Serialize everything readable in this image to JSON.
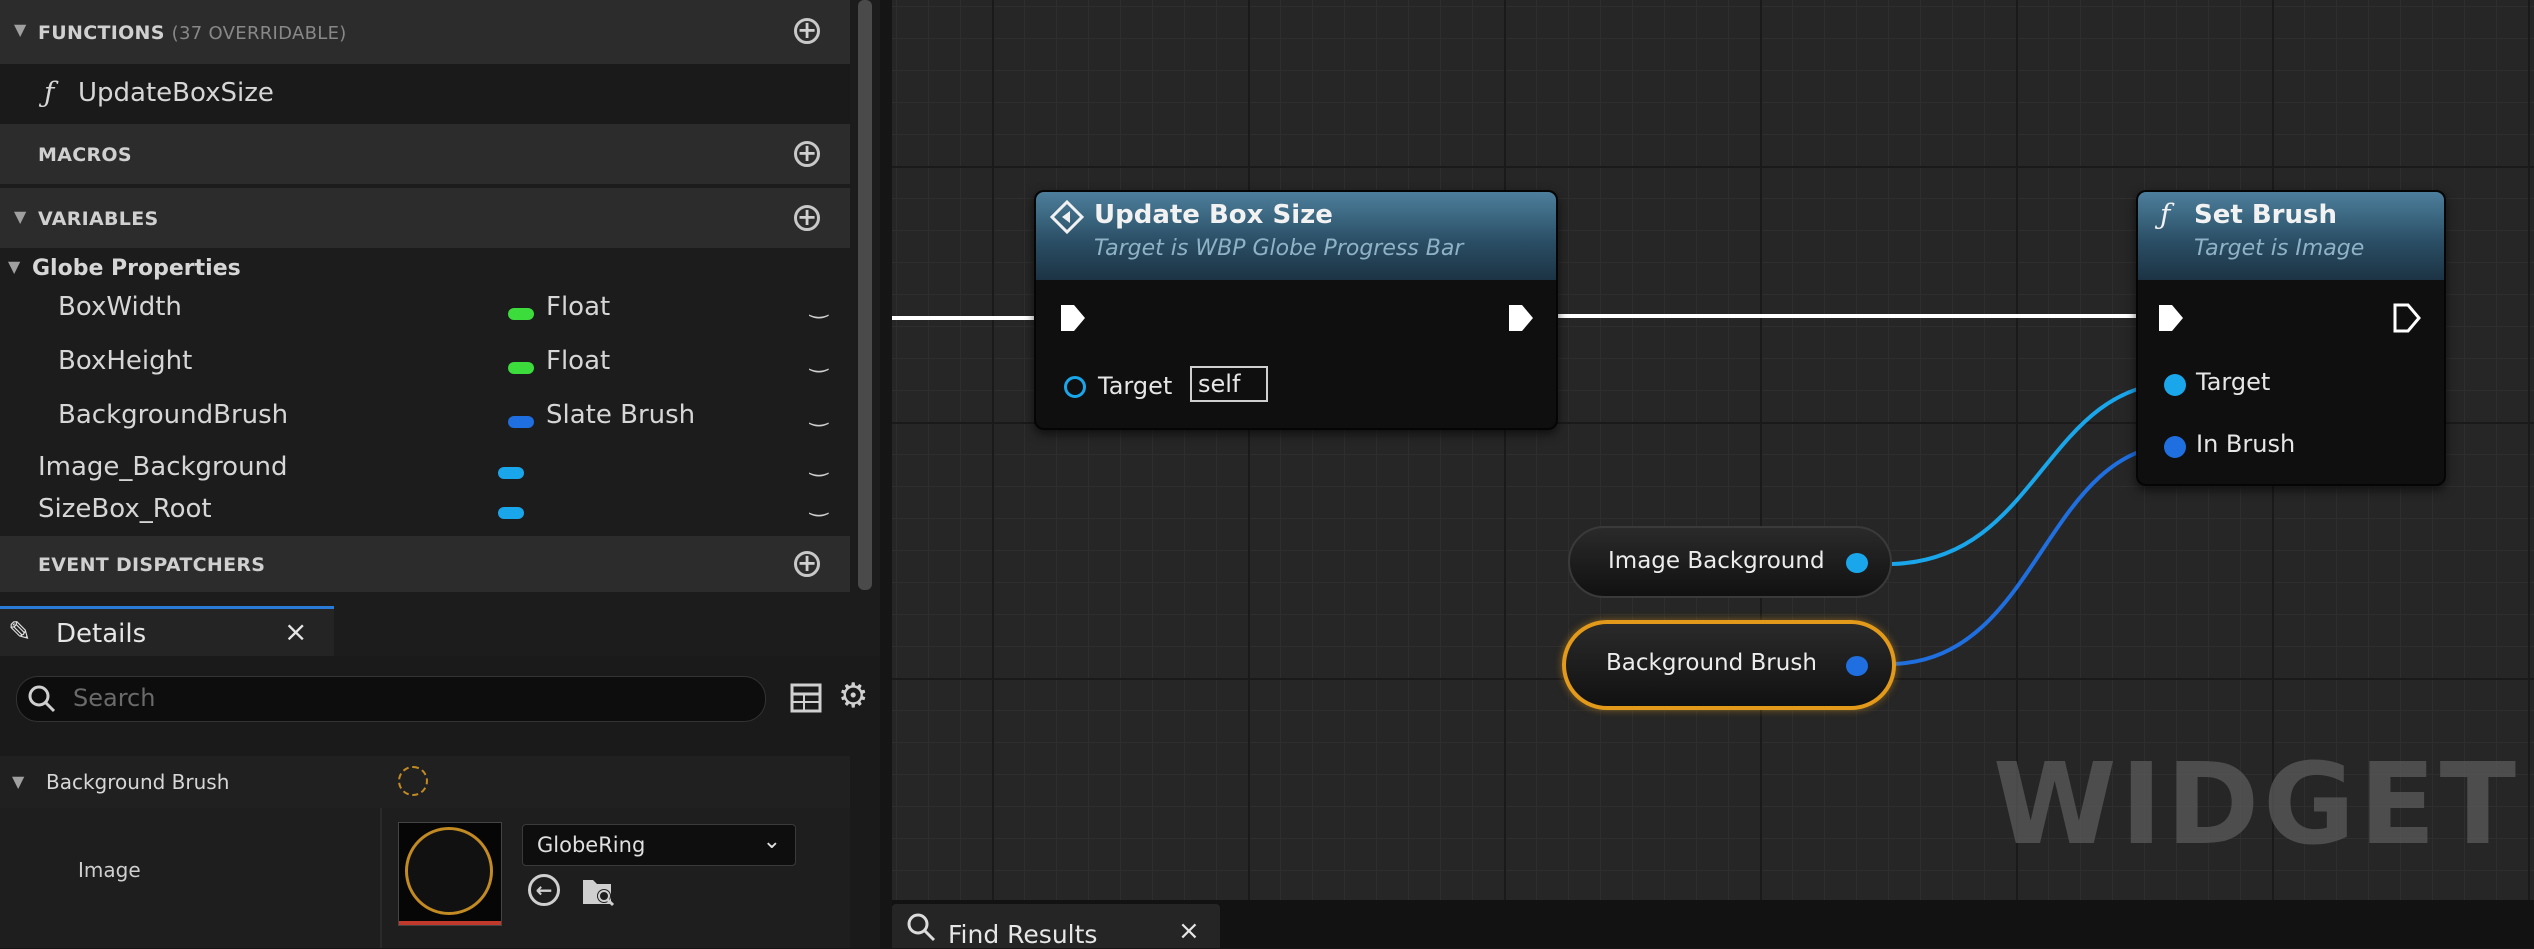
{
  "colors": {
    "accent_blue": "#2a7bd6",
    "float_pin": "#3ddc3d",
    "slate_brush_pin": "#1f6fe0",
    "object_pin": "#1aa6ea",
    "selection": "#e39a1a",
    "exec_wire": "#ffffff"
  },
  "my_blueprint": {
    "functions": {
      "label": "FUNCTIONS",
      "sub": "(37 OVERRIDABLE)",
      "add_icon": "plus-circle-icon"
    },
    "function_items": [
      {
        "icon": "ƒ",
        "label": "UpdateBoxSize"
      }
    ],
    "macros": {
      "label": "MACROS",
      "add_icon": "plus-circle-icon"
    },
    "variables": {
      "label": "VARIABLES",
      "add_icon": "plus-circle-icon"
    },
    "category": {
      "label": "Globe Properties"
    },
    "variable_items": [
      {
        "name": "BoxWidth",
        "type": "Float",
        "color": "#3ddc3d"
      },
      {
        "name": "BoxHeight",
        "type": "Float",
        "color": "#3ddc3d"
      },
      {
        "name": "BackgroundBrush",
        "type": "Slate Brush",
        "color": "#1f6fe0"
      },
      {
        "name": "Image_Background",
        "type": "",
        "color": "#1aa6ea"
      },
      {
        "name": "SizeBox_Root",
        "type": "",
        "color": "#1aa6ea"
      }
    ],
    "event_dispatchers": {
      "label": "EVENT DISPATCHERS",
      "add_icon": "plus-circle-icon"
    }
  },
  "details": {
    "tab_label": "Details",
    "close": "×",
    "search_placeholder": "Search",
    "category": "Background Brush",
    "image_label": "Image",
    "image_value": "GlobeRing"
  },
  "graph": {
    "update_node": {
      "title": "Update Box Size",
      "subtitle": "Target is WBP Globe Progress Bar",
      "pin_target": "Target",
      "target_value": "self"
    },
    "set_brush_node": {
      "icon": "ƒ",
      "title": "Set Brush",
      "subtitle": "Target is Image",
      "pin_target": "Target",
      "pin_in_brush": "In Brush"
    },
    "var_image_background": "Image Background",
    "var_background_brush": "Background Brush",
    "watermark": "WIDGET"
  },
  "find_results": {
    "label": "Find Results",
    "close": "×"
  }
}
